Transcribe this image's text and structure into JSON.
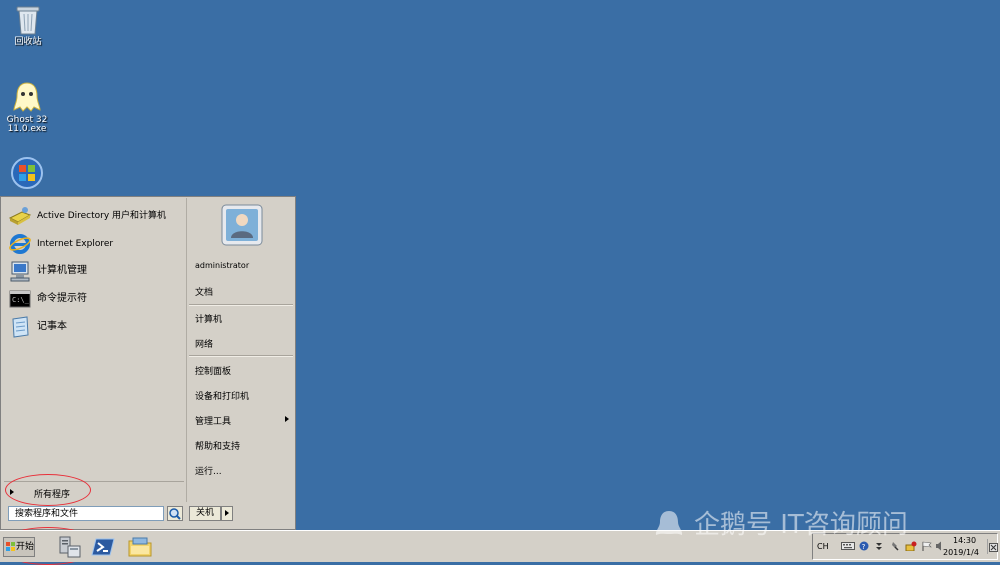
{
  "desktop": {
    "icons": [
      {
        "label": "回收站",
        "icon": "recycle-bin-icon"
      },
      {
        "label": "Ghost 32\n11.0.exe",
        "icon": "ghost-icon"
      },
      {
        "label": "",
        "icon": "windows-orb-icon"
      }
    ]
  },
  "start_menu": {
    "pinned": [
      {
        "label": "Active Directory 用户和计算机",
        "icon": "active-directory-icon"
      },
      {
        "label": "Internet Explorer",
        "icon": "internet-explorer-icon"
      },
      {
        "label": "计算机管理",
        "icon": "computer-management-icon"
      },
      {
        "label": "命令提示符",
        "icon": "command-prompt-icon"
      },
      {
        "label": "记事本",
        "icon": "notepad-icon"
      }
    ],
    "all_programs": "所有程序",
    "search_placeholder": "搜索程序和文件",
    "shutdown_label": "关机",
    "user": {
      "name": "administrator",
      "icon": "user-avatar-icon"
    },
    "right_items": {
      "documents": "文档",
      "computer": "计算机",
      "network": "网络",
      "control_panel": "控制面板",
      "devices_printers": "设备和打印机",
      "admin_tools": "管理工具",
      "help": "帮助和支持",
      "run": "运行..."
    }
  },
  "taskbar": {
    "start_label": "开始",
    "pinned": [
      {
        "icon": "server-manager-icon"
      },
      {
        "icon": "powershell-icon"
      },
      {
        "icon": "explorer-folder-icon"
      }
    ],
    "tray": {
      "language": "CH",
      "time": "14:30",
      "date": "2019/1/4"
    }
  },
  "watermark": "企鹅号 IT咨询顾问",
  "colors": {
    "desktop": "#3a6ea5",
    "chrome": "#d4d0c8",
    "annotation": "#e8303a"
  }
}
